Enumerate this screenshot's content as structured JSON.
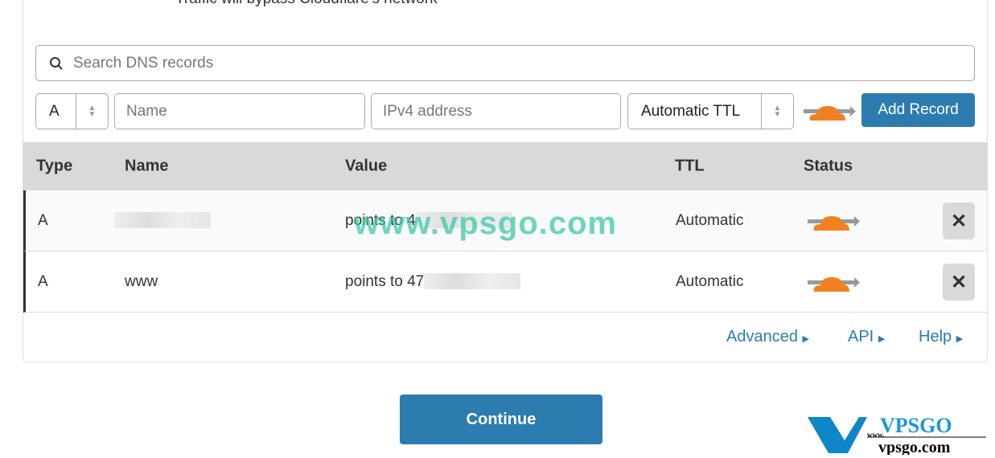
{
  "top_note": "Traffic will bypass Cloudflare's network",
  "search": {
    "placeholder": "Search DNS records"
  },
  "form": {
    "type": "A",
    "name_placeholder": "Name",
    "value_placeholder": "IPv4 address",
    "ttl": "Automatic TTL",
    "add_label": "Add Record"
  },
  "table": {
    "headers": [
      "Type",
      "Name",
      "Value",
      "TTL",
      "Status"
    ],
    "rows": [
      {
        "type": "A",
        "name": "",
        "value": "points to 4",
        "ttl": "Automatic",
        "status": "proxied"
      },
      {
        "type": "A",
        "name": "www",
        "value": "points to 47",
        "ttl": "Automatic",
        "status": "proxied"
      }
    ]
  },
  "links": {
    "advanced": "Advanced",
    "api": "API",
    "help": "Help"
  },
  "continue_label": "Continue",
  "watermark": "www.vpsgo.com",
  "logo": {
    "text": "VPSGO www.vpsgo.com"
  },
  "colors": {
    "accent": "#2c7cb0",
    "cloud": "#f38020"
  }
}
